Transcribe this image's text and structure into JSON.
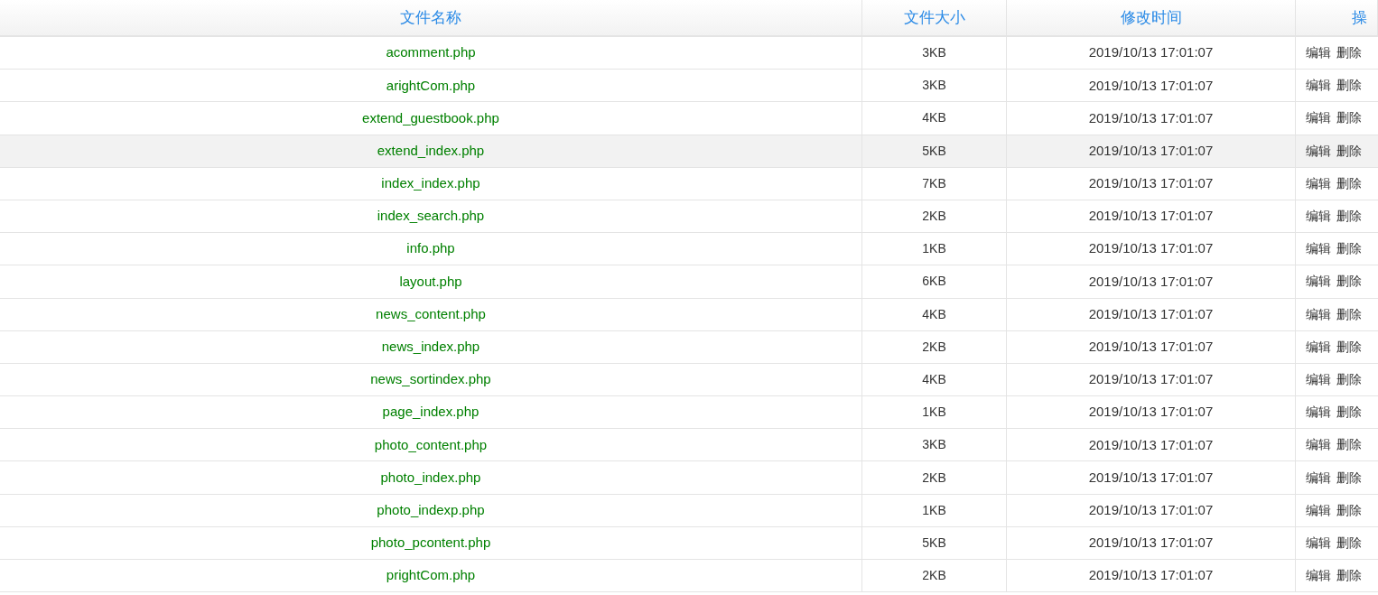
{
  "table": {
    "columns": [
      "文件名称",
      "文件大小",
      "修改时间",
      "操"
    ],
    "rows": [
      {
        "name": "acomment.php",
        "size": "3KB",
        "modified": "2019/10/13 17:01:07",
        "actions": [
          "编辑",
          "删除"
        ],
        "selected": false
      },
      {
        "name": "arightCom.php",
        "size": "3KB",
        "modified": "2019/10/13 17:01:07",
        "actions": [
          "编辑",
          "删除"
        ],
        "selected": false
      },
      {
        "name": "extend_guestbook.php",
        "size": "4KB",
        "modified": "2019/10/13 17:01:07",
        "actions": [
          "编辑",
          "删除"
        ],
        "selected": false
      },
      {
        "name": "extend_index.php",
        "size": "5KB",
        "modified": "2019/10/13 17:01:07",
        "actions": [
          "编辑",
          "删除"
        ],
        "selected": true
      },
      {
        "name": "index_index.php",
        "size": "7KB",
        "modified": "2019/10/13 17:01:07",
        "actions": [
          "编辑",
          "删除"
        ],
        "selected": false
      },
      {
        "name": "index_search.php",
        "size": "2KB",
        "modified": "2019/10/13 17:01:07",
        "actions": [
          "编辑",
          "删除"
        ],
        "selected": false
      },
      {
        "name": "info.php",
        "size": "1KB",
        "modified": "2019/10/13 17:01:07",
        "actions": [
          "编辑",
          "删除"
        ],
        "selected": false
      },
      {
        "name": "layout.php",
        "size": "6KB",
        "modified": "2019/10/13 17:01:07",
        "actions": [
          "编辑",
          "删除"
        ],
        "selected": false
      },
      {
        "name": "news_content.php",
        "size": "4KB",
        "modified": "2019/10/13 17:01:07",
        "actions": [
          "编辑",
          "删除"
        ],
        "selected": false
      },
      {
        "name": "news_index.php",
        "size": "2KB",
        "modified": "2019/10/13 17:01:07",
        "actions": [
          "编辑",
          "删除"
        ],
        "selected": false
      },
      {
        "name": "news_sortindex.php",
        "size": "4KB",
        "modified": "2019/10/13 17:01:07",
        "actions": [
          "编辑",
          "删除"
        ],
        "selected": false
      },
      {
        "name": "page_index.php",
        "size": "1KB",
        "modified": "2019/10/13 17:01:07",
        "actions": [
          "编辑",
          "删除"
        ],
        "selected": false
      },
      {
        "name": "photo_content.php",
        "size": "3KB",
        "modified": "2019/10/13 17:01:07",
        "actions": [
          "编辑",
          "删除"
        ],
        "selected": false
      },
      {
        "name": "photo_index.php",
        "size": "2KB",
        "modified": "2019/10/13 17:01:07",
        "actions": [
          "编辑",
          "删除"
        ],
        "selected": false
      },
      {
        "name": "photo_indexp.php",
        "size": "1KB",
        "modified": "2019/10/13 17:01:07",
        "actions": [
          "编辑",
          "删除"
        ],
        "selected": false
      },
      {
        "name": "photo_pcontent.php",
        "size": "5KB",
        "modified": "2019/10/13 17:01:07",
        "actions": [
          "编辑",
          "删除"
        ],
        "selected": false
      },
      {
        "name": "prightCom.php",
        "size": "2KB",
        "modified": "2019/10/13 17:01:07",
        "actions": [
          "编辑",
          "删除"
        ],
        "selected": false
      }
    ]
  }
}
